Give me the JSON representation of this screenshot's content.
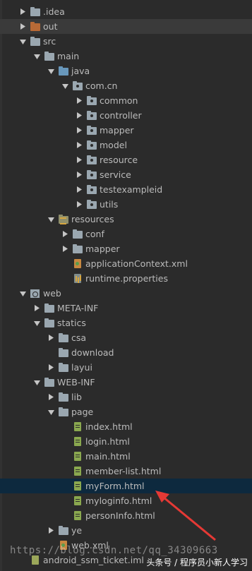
{
  "tree": [
    {
      "label": ".idea",
      "depth": 1,
      "arrow": "right",
      "icon": "folder"
    },
    {
      "label": "out",
      "depth": 1,
      "arrow": "right",
      "icon": "folder-out"
    },
    {
      "label": "src",
      "depth": 1,
      "arrow": "down",
      "icon": "folder"
    },
    {
      "label": "main",
      "depth": 2,
      "arrow": "down",
      "icon": "folder"
    },
    {
      "label": "java",
      "depth": 3,
      "arrow": "down",
      "icon": "folder-blue"
    },
    {
      "label": "com.cn",
      "depth": 4,
      "arrow": "down",
      "icon": "package"
    },
    {
      "label": "common",
      "depth": 5,
      "arrow": "right",
      "icon": "package"
    },
    {
      "label": "controller",
      "depth": 5,
      "arrow": "right",
      "icon": "package"
    },
    {
      "label": "mapper",
      "depth": 5,
      "arrow": "right",
      "icon": "package"
    },
    {
      "label": "model",
      "depth": 5,
      "arrow": "right",
      "icon": "package"
    },
    {
      "label": "resource",
      "depth": 5,
      "arrow": "right",
      "icon": "package"
    },
    {
      "label": "service",
      "depth": 5,
      "arrow": "right",
      "icon": "package"
    },
    {
      "label": "testexampleid",
      "depth": 5,
      "arrow": "right",
      "icon": "package"
    },
    {
      "label": "utils",
      "depth": 5,
      "arrow": "right",
      "icon": "package"
    },
    {
      "label": "resources",
      "depth": 3,
      "arrow": "down",
      "icon": "resources"
    },
    {
      "label": "conf",
      "depth": 4,
      "arrow": "right",
      "icon": "folder"
    },
    {
      "label": "mapper",
      "depth": 4,
      "arrow": "right",
      "icon": "folder"
    },
    {
      "label": "applicationContext.xml",
      "depth": 4,
      "arrow": "none",
      "icon": "xml"
    },
    {
      "label": "runtime.properties",
      "depth": 4,
      "arrow": "none",
      "icon": "props"
    },
    {
      "label": "web",
      "depth": 1,
      "arrow": "down",
      "icon": "web"
    },
    {
      "label": "META-INF",
      "depth": 2,
      "arrow": "right",
      "icon": "folder"
    },
    {
      "label": "statics",
      "depth": 2,
      "arrow": "down",
      "icon": "folder"
    },
    {
      "label": "csa",
      "depth": 3,
      "arrow": "right",
      "icon": "folder"
    },
    {
      "label": "download",
      "depth": 3,
      "arrow": "none",
      "icon": "folder"
    },
    {
      "label": "layui",
      "depth": 3,
      "arrow": "right",
      "icon": "folder"
    },
    {
      "label": "WEB-INF",
      "depth": 2,
      "arrow": "down",
      "icon": "folder"
    },
    {
      "label": "lib",
      "depth": 3,
      "arrow": "right",
      "icon": "folder"
    },
    {
      "label": "page",
      "depth": 3,
      "arrow": "down",
      "icon": "folder"
    },
    {
      "label": "index.html",
      "depth": 4,
      "arrow": "none",
      "icon": "html"
    },
    {
      "label": "login.html",
      "depth": 4,
      "arrow": "none",
      "icon": "html"
    },
    {
      "label": "main.html",
      "depth": 4,
      "arrow": "none",
      "icon": "html"
    },
    {
      "label": "member-list.html",
      "depth": 4,
      "arrow": "none",
      "icon": "html"
    },
    {
      "label": "myForm.html",
      "depth": 4,
      "arrow": "none",
      "icon": "html",
      "selected": true
    },
    {
      "label": "myloginfo.html",
      "depth": 4,
      "arrow": "none",
      "icon": "html"
    },
    {
      "label": "personInfo.html",
      "depth": 4,
      "arrow": "none",
      "icon": "html"
    },
    {
      "label": "ye",
      "depth": 3,
      "arrow": "right",
      "icon": "folder"
    },
    {
      "label": "web.xml",
      "depth": 3,
      "arrow": "none",
      "icon": "xml"
    },
    {
      "label": "android_ssm_ticket.iml",
      "depth": 1,
      "arrow": "none",
      "icon": "iml"
    }
  ],
  "watermark": "https://blog.csdn.net/qq_34309663",
  "attribution": "头条号 / 程序员小新人学习",
  "colors": {
    "background": "#2b2b2b",
    "selected_row": "#0d293e",
    "text": "#bbbbbb",
    "annotation_arrow": "#e53935"
  }
}
